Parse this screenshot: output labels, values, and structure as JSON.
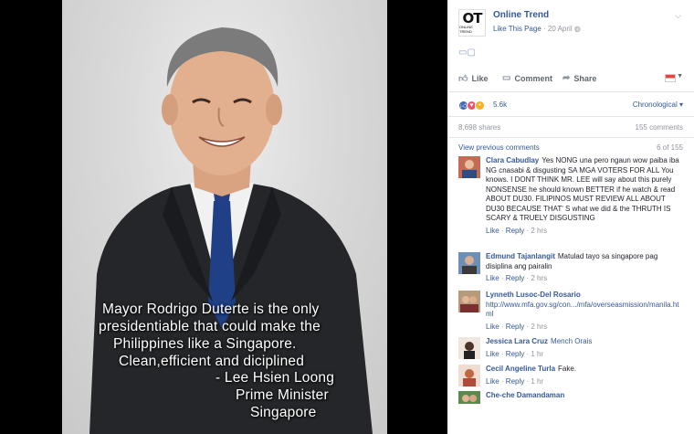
{
  "photo": {
    "quote_lines": [
      "Mayor Rodrigo Duterte is the only",
      "presidentiable that could make the",
      "Philippines like a Singapore.",
      "Clean,efficient and diciplined"
    ],
    "attribution_lines": [
      "- Lee Hsien Loong",
      "Prime Minister",
      "Singapore"
    ]
  },
  "post": {
    "logo_text": "OT",
    "logo_subtext": "ONLINE TREND",
    "page_name": "Online Trend",
    "like_page": "Like This Page",
    "date": "20 April"
  },
  "actions": {
    "like": "Like",
    "comment": "Comment",
    "share": "Share"
  },
  "stats": {
    "reactions_count": "5.6k",
    "sort_label": "Chronological",
    "shares": "8,698 shares",
    "comments": "155 comments",
    "view_previous": "View previous comments",
    "shown_of": "6 of 155"
  },
  "comments": [
    {
      "name": "Clara Cabudlay",
      "text": "Yes NONG una pero ngaun wow paiba iba NG cnasabi & disgusting SA MGA VOTERS FOR ALL You knows. I DONT THINK MR. LEE will say about this purely NONSENSE he should known BETTER if he watch & read ABOUT DU30. FILIPINOS MUST REVIEW ALL ABOUT DU30 BECAUSE THAT' S what we did & the THRUTH IS SCARY & TRUELY DISGUSTING",
      "like": "Like",
      "reply": "Reply",
      "time": "2 hrs"
    },
    {
      "name": "Edmund Tajanlangit",
      "text": "Matulad tayo sa singapore pag disiplina ang pairalin",
      "like": "Like",
      "reply": "Reply",
      "time": "2 hrs"
    },
    {
      "name": "Lynneth Lusoc-Del Rosario",
      "text": "http://www.mfa.gov.sg/con.../mfa/overseasmission/manila.html",
      "like": "Like",
      "reply": "Reply",
      "time": "2 hrs"
    },
    {
      "name": "Jessica Lara Cruz",
      "text": "Mench Orais",
      "like": "Like",
      "reply": "Reply",
      "time": "1 hr"
    },
    {
      "name": "Cecil Angeline Turla",
      "text": "Fake.",
      "like": "Like",
      "reply": "Reply",
      "time": "1 hr"
    },
    {
      "name": "Che-che Damandaman",
      "text": ""
    }
  ]
}
